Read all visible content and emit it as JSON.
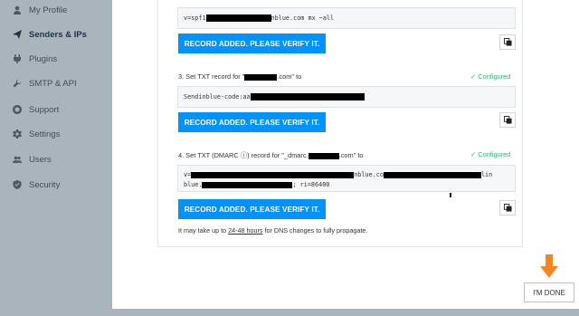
{
  "sidebar": {
    "items": [
      {
        "label": "My Profile",
        "icon": "user-icon"
      },
      {
        "label": "Senders & IPs",
        "icon": "paper-plane-icon",
        "active": true
      },
      {
        "label": "Plugins",
        "icon": "plug-icon"
      },
      {
        "label": "SMTP & API",
        "icon": "wrench-icon"
      },
      {
        "label": "Support",
        "icon": "lifebuoy-icon"
      },
      {
        "label": "Settings",
        "icon": "gear-icon"
      },
      {
        "label": "Users",
        "icon": "users-icon"
      },
      {
        "label": "Security",
        "icon": "shield-icon"
      }
    ]
  },
  "records": {
    "spf": {
      "value_start": "v=spf1 ",
      "value_end": "nblue.com mx ~all",
      "button_label": "RECORD ADDED. PLEASE VERIFY IT."
    },
    "step3": {
      "label_start": "3. Set TXT record for \"",
      "label_end": ".com\" to",
      "status": "✓ Configured",
      "value_start": "Sendinblue-code:aa",
      "button_label": "RECORD ADDED. PLEASE VERIFY IT."
    },
    "step4": {
      "label_start": "4. Set TXT (DMARC ⓘ) record for \"_dmarc.",
      "label_end": ".com\" to",
      "status": "✓ Configured",
      "line1_start": "v=",
      "line1_mid": "nblue.co",
      "line1_end": "lin",
      "line2_start": "blue.",
      "line2_end": "; ri=86400",
      "button_label": "RECORD ADDED. PLEASE VERIFY IT."
    }
  },
  "note": {
    "before": "It may take up to ",
    "highlight": "24-48 hours",
    "after": " for DNS changes to fully propagate."
  },
  "footer": {
    "done_label": "I'M DONE"
  },
  "colors": {
    "accent": "#0092ff",
    "configured": "#2bb673",
    "arrow": "#f5861f",
    "sidebar": "#a9b4bd"
  }
}
